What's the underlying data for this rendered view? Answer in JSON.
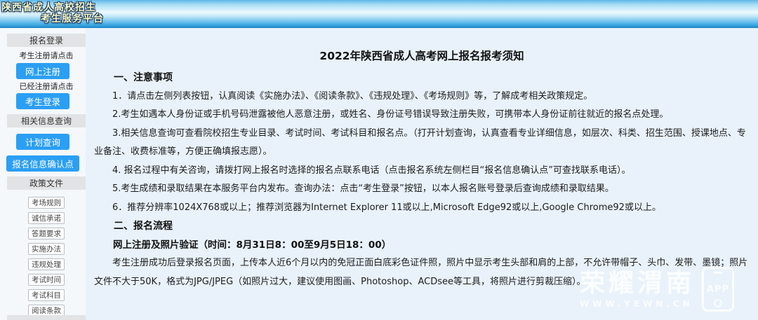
{
  "header": {
    "title_line1": "陕西省成人高校招生",
    "title_line2": "考生服务平台"
  },
  "sidebar": {
    "login_header": "报名登录",
    "register_hint": "考生注册请点击",
    "register_button": "网上注册",
    "login_hint": "已经注册请点击",
    "login_button": "考生登录",
    "info_header": "相关信息查询",
    "plan_button": "计划查询",
    "confirm_button": "报名信息确认点",
    "policy_header": "政策文件",
    "policy_items": [
      "考场规则",
      "诚信承诺",
      "答题要求",
      "实施办法",
      "违规处理",
      "考试时间",
      "考试科目",
      "阅读条款"
    ]
  },
  "main": {
    "title": "2022年陕西省成人高考网上报名报考须知",
    "section1_heading": "一、注意事项",
    "notice_items": [
      "1．请点击左侧列表按钮，认真阅读《实施办法》、《阅读条款》、《违规处理》、《考场规则》等，了解成考相关政策规定。",
      "2.考生如遇本人身份证或手机号码泄露被他人恶意注册，或姓名、身份证号错误导致注册失败，可携带本人身份证前往就近的报名点处理。",
      "3.相关信息查询可查看院校招生专业目录、考试时间、考试科目和报名点。（打开计划查询，认真查看专业详细信息，如层次、科类、招生范围、授课地点、专业备注、收费标准等，方便正确填报志愿）。",
      "4. 报名过程中有关咨询，请拨打网上报名时选择的报名点联系电话（点击报名系统左侧栏目“报名信息确认点”可查找联系电话）。",
      "5.考生成绩和录取结果在本服务平台内发布。查询办法：点击“考生登录”按钮，以本人报名账号登录后查询成绩和录取结果。",
      "6．推荐分辨率1024X768或以上；推荐浏览器为Internet Explorer 11或以上,Microsoft Edge92或以上,Google Chrome92或以上。"
    ],
    "section2_heading": "二、报名流程",
    "schedule_heading": "网上注册及照片验证（时间：8月31日8：00至9月5日18：00）",
    "schedule_paragraph": "考生注册成功后登录报名页面，上传本人近6个月以内的免冠正面白底彩色证件照，照片中显示考生头部和肩的上部，不允许带帽子、头巾、发带、墨镜；照片文件不大于50K，格式为JPG/JPEG（如照片过大，建议使用图画、Photoshop、ACDsee等工具，将照片进行剪裁压缩）。"
  },
  "watermark": {
    "brand": "荣耀渭南",
    "url": "WWW.YEWN.CN",
    "app_label": "APP"
  },
  "colors": {
    "accent_blue": "#2b9ff3",
    "header_gradient_top": "#5fb7e8",
    "content_bg": "#e9f2fb"
  }
}
